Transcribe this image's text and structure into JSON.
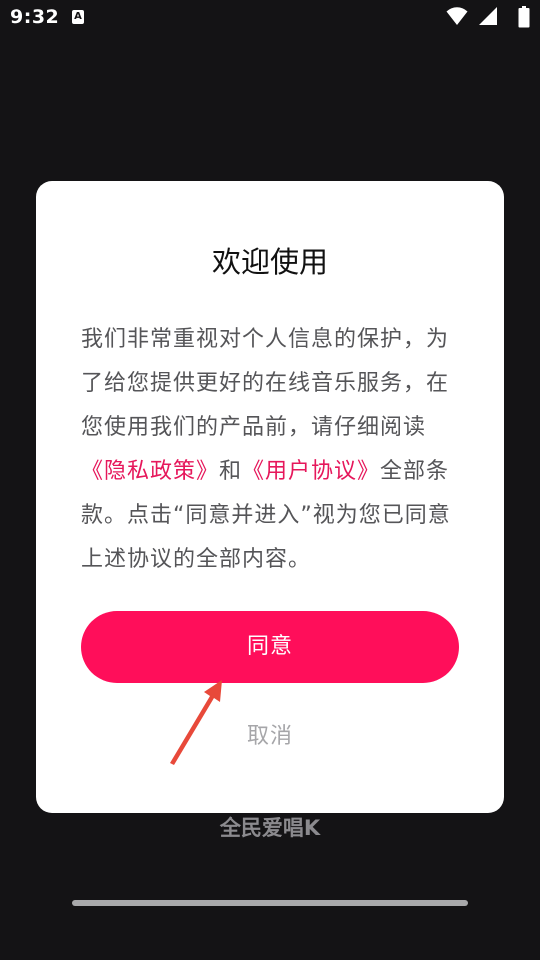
{
  "status_bar": {
    "time": "9:32",
    "notification_icon_letter": "A",
    "icons": [
      "wifi-icon",
      "signal-icon",
      "battery-icon"
    ]
  },
  "dialog": {
    "title": "欢迎使用",
    "body_parts": {
      "p1": "我们非常重视对个人信息的保护，为了给您提供更好的在线音乐服务，在您使用我们的产品前，请仔细阅读",
      "privacy_link": "《隐私政策》",
      "and": "和",
      "agreement_link": "《用户协议》",
      "p2": "全部条款。点击“同意并进入”视为您已同意上述协议的全部内容。"
    },
    "agree_label": "同意",
    "cancel_label": "取消"
  },
  "app_name": "全民爱唱K",
  "colors": {
    "accent": "#ff0e5a",
    "link": "#e6175b",
    "background": "#141315",
    "arrow": "#e8493a"
  }
}
